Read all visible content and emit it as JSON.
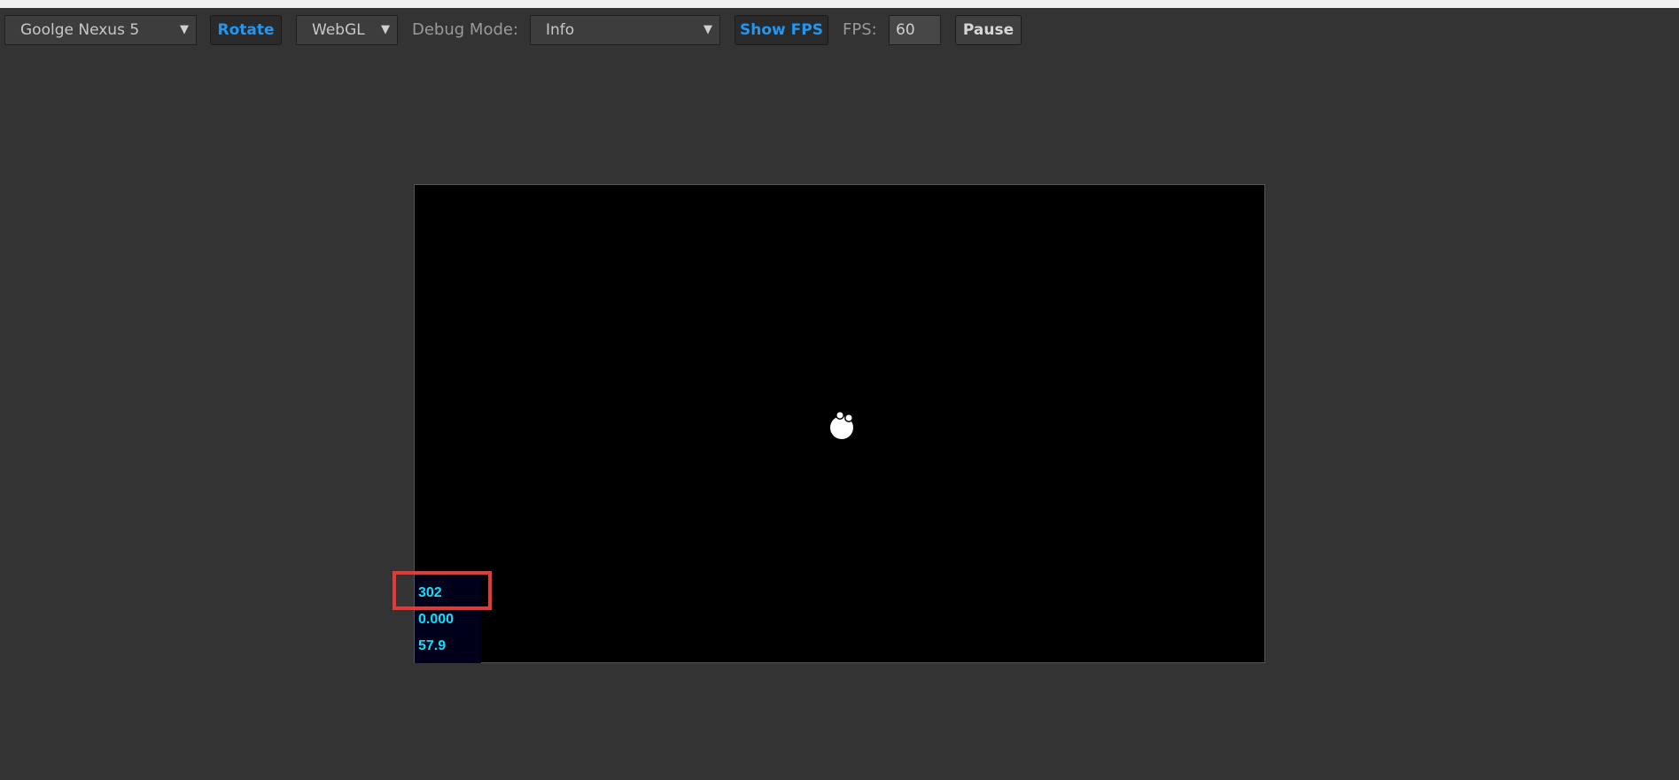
{
  "toolbar": {
    "device_select": "Goolge Nexus 5",
    "rotate_label": "Rotate",
    "renderer_select": "WebGL",
    "debug_mode_label": "Debug Mode:",
    "debug_mode_select": "Info",
    "show_fps_label": "Show FPS",
    "fps_label": "FPS:",
    "fps_value": "60",
    "pause_label": "Pause"
  },
  "stats": {
    "line1": "302",
    "line2": "0.000",
    "line3": "57.9"
  },
  "colors": {
    "background": "#333333",
    "accent": "#2196f3",
    "stats_text": "#00e5ff",
    "highlight": "#e53935"
  }
}
